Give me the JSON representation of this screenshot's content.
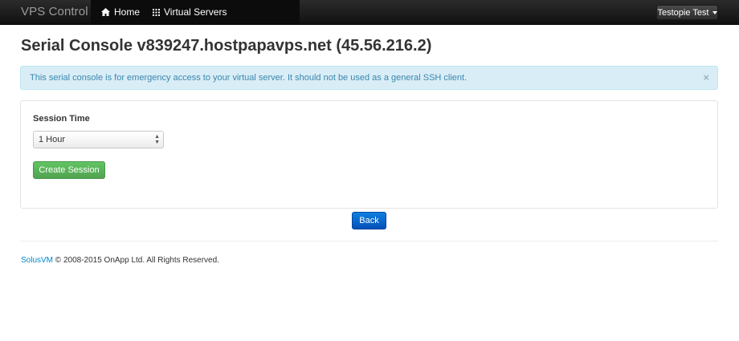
{
  "navbar": {
    "brand": "VPS Control",
    "items": [
      {
        "label": "Home",
        "icon": "home-icon"
      },
      {
        "label": "Virtual Servers",
        "icon": "grid-icon"
      }
    ],
    "user_menu": "Testopie Test"
  },
  "page": {
    "title": "Serial Console v839247.hostpapavps.net (45.56.216.2)"
  },
  "alert": {
    "message": "This serial console is for emergency access to your virtual server. It should not be used as a general SSH client.",
    "close": "×"
  },
  "form": {
    "session_time_label": "Session Time",
    "session_time_value": "1 Hour",
    "create_button": "Create Session"
  },
  "actions": {
    "back": "Back"
  },
  "footer": {
    "brand_link": "SolusVM",
    "text": "© 2008-2015 OnApp Ltd. All Rights Reserved."
  },
  "colors": {
    "navbar": "#1b1b1b",
    "alert_bg": "#d9edf7",
    "alert_text": "#3a87ad",
    "success": "#5bb75b",
    "primary": "#0668d6",
    "link": "#0088cc"
  }
}
